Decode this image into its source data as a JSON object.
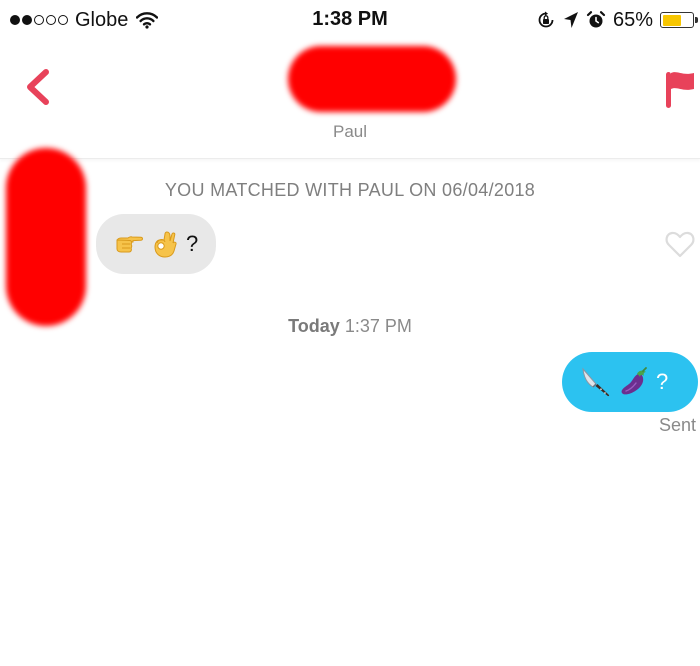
{
  "status_bar": {
    "carrier": "Globe",
    "signal_bars_filled": 2,
    "signal_bars_total": 5,
    "time": "1:38 PM",
    "battery_percent_label": "65%",
    "battery_level": 0.65,
    "icons": [
      "wifi-icon",
      "rotation-lock-icon",
      "location-arrow-icon",
      "alarm-icon",
      "battery-icon"
    ]
  },
  "header": {
    "back_icon": "chevron-left-icon",
    "match_name": "Paul",
    "report_icon": "flag-icon"
  },
  "chat": {
    "match_notice": "YOU MATCHED WITH PAUL ON 06/04/2018",
    "messages": [
      {
        "direction": "received",
        "emojis": [
          "pointing-right-emoji",
          "ok-hand-emoji"
        ],
        "text": "?",
        "like_icon": "heart-outline-icon"
      },
      {
        "direction": "sent",
        "emojis": [
          "knife-emoji",
          "eggplant-emoji"
        ],
        "text": "?",
        "status": "Sent"
      }
    ],
    "time_divider": {
      "day": "Today",
      "time": "1:37 PM"
    }
  },
  "colors": {
    "accent": "#e8425a",
    "sent_bubble": "#2cc2f0",
    "received_bubble": "#e8e8e8",
    "battery": "#f7c600",
    "muted_text": "#8a8a8a"
  }
}
